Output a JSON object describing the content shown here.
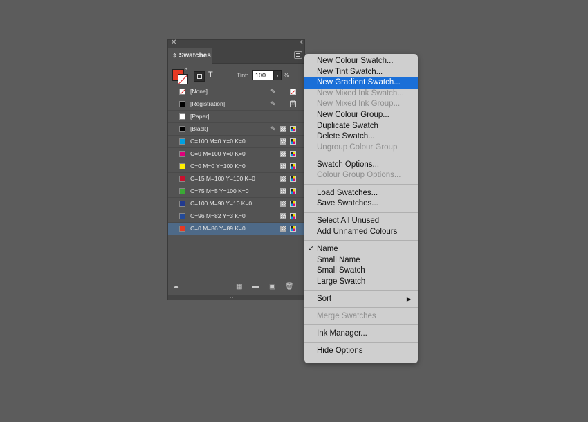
{
  "panel": {
    "tab_title": "Swatches",
    "tint_label": "Tint:",
    "tint_value": "100",
    "tint_unit": "%",
    "text_button": "T",
    "swatches": [
      {
        "name": "[None]",
        "color": "#ffffff",
        "kind": "none",
        "locked": true,
        "selected": false
      },
      {
        "name": "[Registration]",
        "color": "#000000",
        "kind": "reg",
        "locked": true,
        "selected": false
      },
      {
        "name": "[Paper]",
        "color": "#ffffff",
        "kind": "plain",
        "locked": false,
        "selected": false
      },
      {
        "name": "[Black]",
        "color": "#000000",
        "kind": "cmyk",
        "locked": true,
        "selected": false
      },
      {
        "name": "C=100 M=0 Y=0 K=0",
        "color": "#00a0e0",
        "kind": "cmyk",
        "locked": false,
        "selected": false
      },
      {
        "name": "C=0 M=100 Y=0 K=0",
        "color": "#e0007a",
        "kind": "cmyk",
        "locked": false,
        "selected": false
      },
      {
        "name": "C=0 M=0 Y=100 K=0",
        "color": "#fff000",
        "kind": "cmyk",
        "locked": false,
        "selected": false
      },
      {
        "name": "C=15 M=100 Y=100 K=0",
        "color": "#c8102e",
        "kind": "cmyk",
        "locked": false,
        "selected": false
      },
      {
        "name": "C=75 M=5 Y=100 K=0",
        "color": "#3aa935",
        "kind": "cmyk",
        "locked": false,
        "selected": false
      },
      {
        "name": "C=100 M=90 Y=10 K=0",
        "color": "#223a8f",
        "kind": "cmyk",
        "locked": false,
        "selected": false
      },
      {
        "name": "C=96 M=82 Y=3 K=0",
        "color": "#244a9a",
        "kind": "cmyk",
        "locked": false,
        "selected": false
      },
      {
        "name": "C=0 M=86 Y=89 K=0",
        "color": "#e63a24",
        "kind": "cmyk",
        "locked": false,
        "selected": true
      }
    ]
  },
  "menu": {
    "items": [
      {
        "label": "New Colour Swatch...",
        "state": "normal"
      },
      {
        "label": "New Tint Swatch...",
        "state": "normal"
      },
      {
        "label": "New Gradient Swatch...",
        "state": "highlight"
      },
      {
        "label": "New Mixed Ink Swatch...",
        "state": "disabled"
      },
      {
        "label": "New Mixed Ink Group...",
        "state": "disabled"
      },
      {
        "label": "New Colour Group...",
        "state": "normal"
      },
      {
        "label": "Duplicate Swatch",
        "state": "normal"
      },
      {
        "label": "Delete Swatch...",
        "state": "normal"
      },
      {
        "label": "Ungroup Colour Group",
        "state": "disabled"
      },
      {
        "sep": true
      },
      {
        "label": "Swatch Options...",
        "state": "normal"
      },
      {
        "label": "Colour Group Options...",
        "state": "disabled"
      },
      {
        "sep": true
      },
      {
        "label": "Load Swatches...",
        "state": "normal"
      },
      {
        "label": "Save Swatches...",
        "state": "normal"
      },
      {
        "sep": true
      },
      {
        "label": "Select All Unused",
        "state": "normal"
      },
      {
        "label": "Add Unnamed Colours",
        "state": "normal"
      },
      {
        "sep": true
      },
      {
        "label": "Name",
        "state": "normal",
        "checked": true
      },
      {
        "label": "Small Name",
        "state": "normal"
      },
      {
        "label": "Small Swatch",
        "state": "normal"
      },
      {
        "label": "Large Swatch",
        "state": "normal"
      },
      {
        "sep": true
      },
      {
        "label": "Sort",
        "state": "normal",
        "submenu": true
      },
      {
        "sep": true
      },
      {
        "label": "Merge Swatches",
        "state": "disabled"
      },
      {
        "sep": true
      },
      {
        "label": "Ink Manager...",
        "state": "normal"
      },
      {
        "sep": true
      },
      {
        "label": "Hide Options",
        "state": "normal"
      }
    ]
  }
}
